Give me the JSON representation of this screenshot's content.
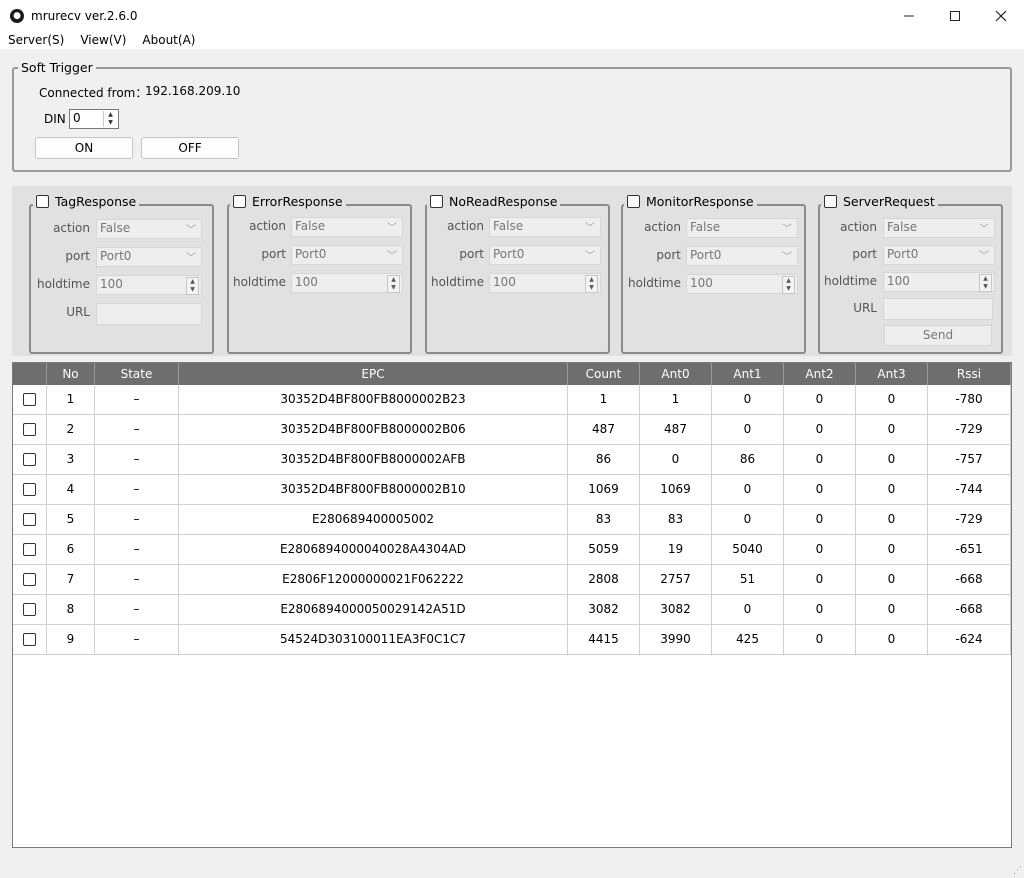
{
  "window": {
    "title": "mrurecv ver.2.6.0",
    "icon": "app-logo-icon"
  },
  "menu": [
    {
      "label": "Server(S)"
    },
    {
      "label": "View(V)"
    },
    {
      "label": "About(A)"
    }
  ],
  "soft_trigger": {
    "legend": "Soft Trigger",
    "connected_label": "Connected from：",
    "connected_ip": "192.168.209.10",
    "din_label": "DIN",
    "din_value": "0",
    "on_label": "ON",
    "off_label": "OFF"
  },
  "responses": [
    {
      "title": "TagResponse",
      "action_label": "action",
      "action": "False",
      "port_label": "port",
      "port": "Port0",
      "holdtime_label": "holdtime",
      "holdtime": "100",
      "url_label": "URL"
    },
    {
      "title": "ErrorResponse",
      "action_label": "action",
      "action": "False",
      "port_label": "port",
      "port": "Port0",
      "holdtime_label": "holdtime",
      "holdtime": "100"
    },
    {
      "title": "NoReadResponse",
      "action_label": "action",
      "action": "False",
      "port_label": "port",
      "port": "Port0",
      "holdtime_label": "holdtime",
      "holdtime": "100"
    },
    {
      "title": "MonitorResponse",
      "action_label": "action",
      "action": "False",
      "port_label": "port",
      "port": "Port0",
      "holdtime_label": "holdtime",
      "holdtime": "100"
    },
    {
      "title": "ServerRequest",
      "action_label": "action",
      "action": "False",
      "port_label": "port",
      "port": "Port0",
      "holdtime_label": "holdtime",
      "holdtime": "100",
      "url_label": "URL",
      "send_label": "Send"
    }
  ],
  "table": {
    "columns": [
      "No",
      "State",
      "EPC",
      "Count",
      "Ant0",
      "Ant1",
      "Ant2",
      "Ant3",
      "Rssi"
    ],
    "rows": [
      [
        "1",
        "–",
        "30352D4BF800FB8000002B23",
        "1",
        "1",
        "0",
        "0",
        "0",
        "-780"
      ],
      [
        "2",
        "–",
        "30352D4BF800FB8000002B06",
        "487",
        "487",
        "0",
        "0",
        "0",
        "-729"
      ],
      [
        "3",
        "–",
        "30352D4BF800FB8000002AFB",
        "86",
        "0",
        "86",
        "0",
        "0",
        "-757"
      ],
      [
        "4",
        "–",
        "30352D4BF800FB8000002B10",
        "1069",
        "1069",
        "0",
        "0",
        "0",
        "-744"
      ],
      [
        "5",
        "–",
        "E280689400005002",
        "83",
        "83",
        "0",
        "0",
        "0",
        "-729"
      ],
      [
        "6",
        "–",
        "E2806894000040028A4304AD",
        "5059",
        "19",
        "5040",
        "0",
        "0",
        "-651"
      ],
      [
        "7",
        "–",
        "E2806F12000000021F062222",
        "2808",
        "2757",
        "51",
        "0",
        "0",
        "-668"
      ],
      [
        "8",
        "–",
        "E2806894000050029142A51D",
        "3082",
        "3082",
        "0",
        "0",
        "0",
        "-668"
      ],
      [
        "9",
        "–",
        "54524D303100011EA3F0C1C7",
        "4415",
        "3990",
        "425",
        "0",
        "0",
        "-624"
      ]
    ]
  }
}
